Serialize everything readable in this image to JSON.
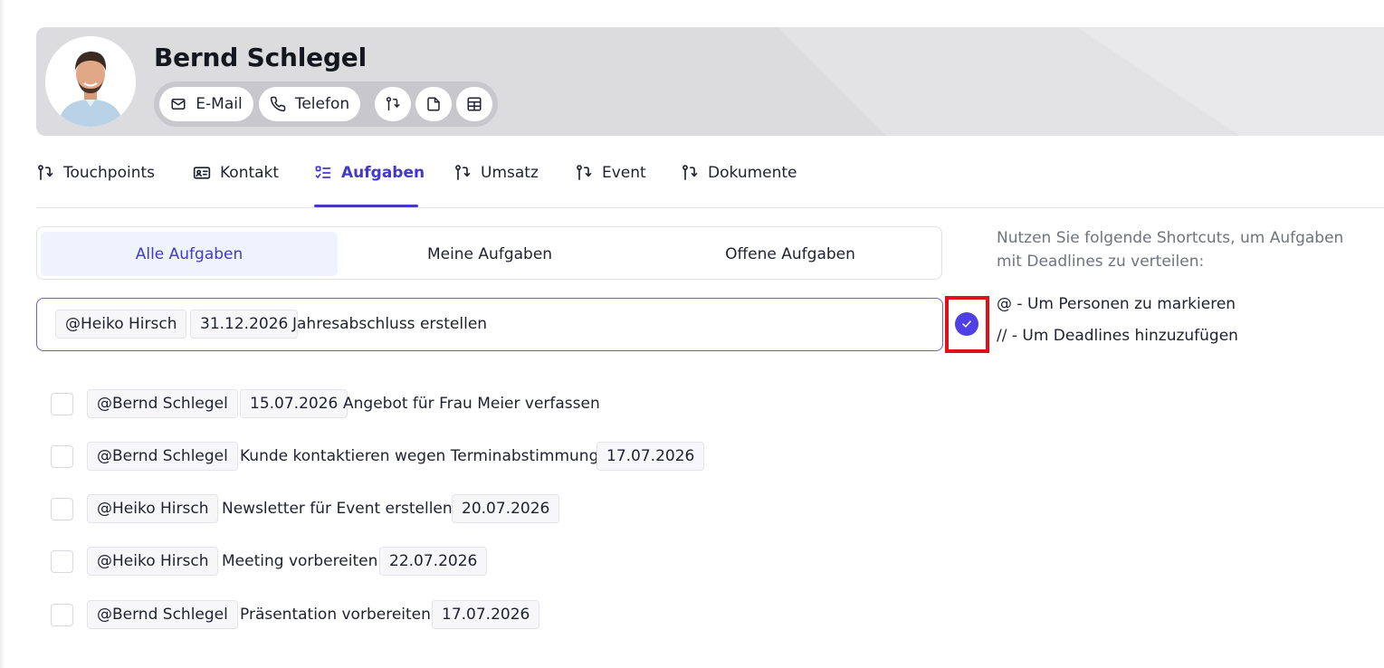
{
  "contact": {
    "name": "Bernd Schlegel",
    "actions": {
      "email_label": "E-Mail",
      "phone_label": "Telefon"
    }
  },
  "tabs": [
    {
      "label": "Touchpoints",
      "icon": "git-pull-request-icon",
      "active": false
    },
    {
      "label": "Kontakt",
      "icon": "contact-card-icon",
      "active": false
    },
    {
      "label": "Aufgaben",
      "icon": "task-list-icon",
      "active": true
    },
    {
      "label": "Umsatz",
      "icon": "git-pull-request-icon",
      "active": false
    },
    {
      "label": "Event",
      "icon": "git-pull-request-icon",
      "active": false
    },
    {
      "label": "Dokumente",
      "icon": "git-pull-request-icon",
      "active": false
    }
  ],
  "filters": [
    {
      "label": "Alle Aufgaben",
      "active": true
    },
    {
      "label": "Meine Aufgaben",
      "active": false
    },
    {
      "label": "Offene Aufgaben",
      "active": false
    }
  ],
  "new_task": {
    "mention": "@Heiko Hirsch",
    "date": "31.12.2026",
    "text": "Jahresabschluss erstellen"
  },
  "hints": {
    "intro": "Nutzen Sie folgende Shortcuts, um Aufgaben mit Deadlines zu verteilen:",
    "mention_shortcut": "@ - Um Personen zu markieren",
    "deadline_shortcut": "// - Um Deadlines hinzuzufügen"
  },
  "tasks": [
    {
      "mention": "@Bernd Schlegel",
      "date": "15.07.2026",
      "text": "Angebot für Frau Meier verfassen",
      "checked": false
    },
    {
      "mention": "@Bernd Schlegel",
      "date": "17.07.2026",
      "text": "Kunde kontaktieren wegen Terminabstimmung",
      "checked": false
    },
    {
      "mention": "@Heiko Hirsch",
      "date": "20.07.2026",
      "text": "Newsletter für Event erstellen",
      "checked": false
    },
    {
      "mention": "@Heiko Hirsch",
      "date": "22.07.2026",
      "text": "Meeting vorbereiten",
      "checked": false
    },
    {
      "mention": "@Bernd Schlegel",
      "date": "17.07.2026",
      "text": "Präsentation vorbereiten",
      "checked": false
    }
  ],
  "colors": {
    "accent": "#4338ca",
    "submit": "#4f3fe6",
    "highlight_box": "#e0101a"
  }
}
